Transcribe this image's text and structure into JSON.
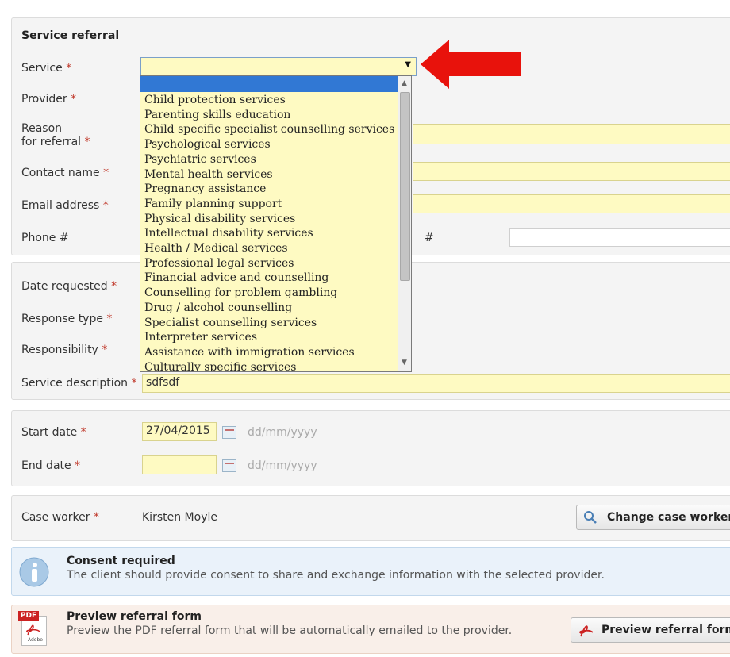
{
  "referral": {
    "heading": "Service referral",
    "service_label": "Service",
    "provider_label": "Provider",
    "reason_label_1": "Reason",
    "reason_label_2": "for referral",
    "contact_label": "Contact name",
    "email_label": "Email address",
    "phone_label": "Phone #",
    "phone2_label": "#",
    "required_mark": "*"
  },
  "service_dropdown": {
    "options": [
      "Child protection services",
      "Parenting skills education",
      "Child specific specialist counselling services",
      "Psychological services",
      "Psychiatric services",
      "Mental health services",
      "Pregnancy assistance",
      "Family planning support",
      "Physical disability services",
      "Intellectual disability services",
      "Health / Medical services",
      "Professional legal services",
      "Financial advice and counselling",
      "Counselling for problem gambling",
      "Drug / alcohol counselling",
      "Specialist counselling services",
      "Interpreter services",
      "Assistance with immigration services",
      "Culturally specific services"
    ],
    "arrow_color": "#e8120c"
  },
  "request": {
    "date_requested_label": "Date requested",
    "response_type_label": "Response type",
    "responsibility_label": "Responsibility",
    "service_description_label": "Service description",
    "service_description_value": "sdfsdf"
  },
  "dates": {
    "start_label": "Start date",
    "start_value": "27/04/2015",
    "end_label": "End date",
    "end_value": "",
    "format_hint": "dd/mm/yyyy"
  },
  "case_worker": {
    "label": "Case worker",
    "value": "Kirsten Moyle",
    "change_button": "Change case worker"
  },
  "consent": {
    "title": "Consent required",
    "text": "The client should provide consent to share and exchange information with the selected provider."
  },
  "preview": {
    "title": "Preview referral form",
    "text": "Preview the PDF referral form that will be automatically emailed to the provider.",
    "button": "Preview referral form",
    "pdf_badge": "PDF",
    "adobe_label": "Adobe"
  }
}
